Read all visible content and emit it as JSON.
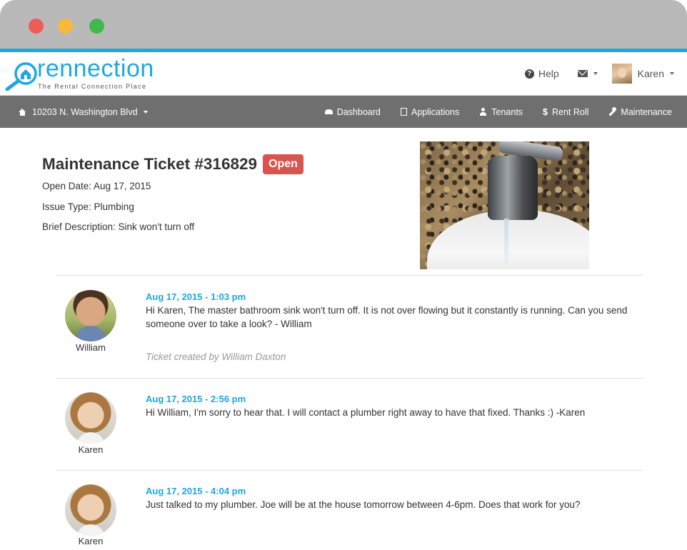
{
  "brand": {
    "name": "rennection",
    "tagline": "The Rental Connection Place",
    "accent": "#1ea7e0"
  },
  "header": {
    "help_label": "Help",
    "user_name": "Karen"
  },
  "navbar": {
    "property": "10203 N. Washington Blvd",
    "items": [
      {
        "label": "Dashboard",
        "icon": "dashboard-icon"
      },
      {
        "label": "Applications",
        "icon": "document-icon"
      },
      {
        "label": "Tenants",
        "icon": "user-icon"
      },
      {
        "label": "Rent Roll",
        "icon": "dollar-icon"
      },
      {
        "label": "Maintenance",
        "icon": "wrench-icon"
      }
    ]
  },
  "ticket": {
    "title": "Maintenance Ticket #316829",
    "status": "Open",
    "status_color": "#d9534f",
    "open_date": "Open Date: Aug 17, 2015",
    "issue_type": "Issue Type: Plumbing",
    "description": "Brief Description: Sink won't turn off"
  },
  "comments": [
    {
      "author": "William",
      "date": "Aug 17, 2015 - 1:03 pm",
      "body": "Hi Karen, The master bathroom sink won't turn off. It is not over flowing but it constantly is running. Can you send someone over to take a look? - William",
      "note": "Ticket created by William Daxton"
    },
    {
      "author": "Karen",
      "date": "Aug 17, 2015 - 2:56 pm",
      "body": "Hi William, I'm sorry to hear that. I will contact a plumber right away to have that fixed. Thanks :) -Karen"
    },
    {
      "author": "Karen",
      "date": "Aug 17, 2015 - 4:04 pm",
      "body": "Just talked to my plumber. Joe will be at the house tomorrow between 4-6pm. Does that work for you?"
    }
  ]
}
